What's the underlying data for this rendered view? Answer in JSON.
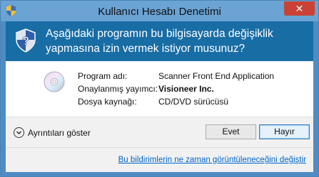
{
  "window": {
    "title": "Kullanıcı Hesabı Denetimi",
    "close_label": "✕"
  },
  "header": {
    "message": "Aşağıdaki programın bu bilgisayarda değişiklik yapmasına izin vermek istiyor musunuz?"
  },
  "program_info": {
    "rows": [
      {
        "label": "Program adı:",
        "value": "Scanner Front End Application"
      },
      {
        "label": "Onaylanmış yayımcı:",
        "value": "Visioneer Inc."
      },
      {
        "label": "Dosya kaynağı:",
        "value": "CD/DVD sürücüsü"
      }
    ]
  },
  "footer": {
    "details_label": "Ayrıntıları göster",
    "yes_label": "Evet",
    "no_label": "Hayır",
    "help_link": "Bu bildirimlerin ne zaman görüntüleneceğini değiştir"
  },
  "icons": {
    "title_icon": "uac-shield-icon",
    "header_icon": "question-shield-icon",
    "program_icon": "cd-disc-icon",
    "details_icon": "chevron-down-circle-icon"
  },
  "colors": {
    "header_bg": "#186da5",
    "titlebar_bg": "#6aa3d4",
    "close_bg": "#c94235",
    "link": "#0066cc"
  }
}
